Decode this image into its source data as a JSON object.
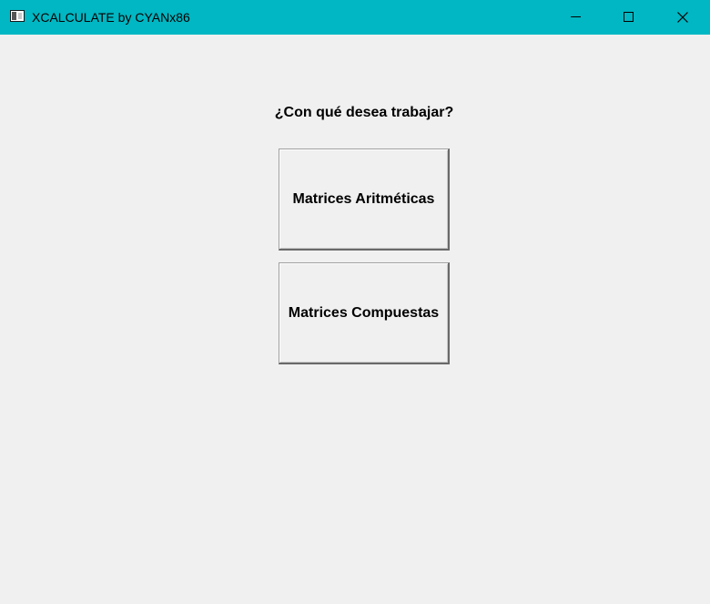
{
  "window": {
    "title": "XCALCULATE by CYANx86",
    "titlebar_color": "#00b7c3",
    "controls": {
      "minimize_icon": "minimize-icon",
      "maximize_icon": "maximize-icon",
      "close_icon": "close-icon"
    }
  },
  "main": {
    "prompt": "¿Con qué desea trabajar?",
    "buttons": [
      {
        "label": "Matrices Aritméticas"
      },
      {
        "label": "Matrices Compuestas"
      }
    ]
  }
}
